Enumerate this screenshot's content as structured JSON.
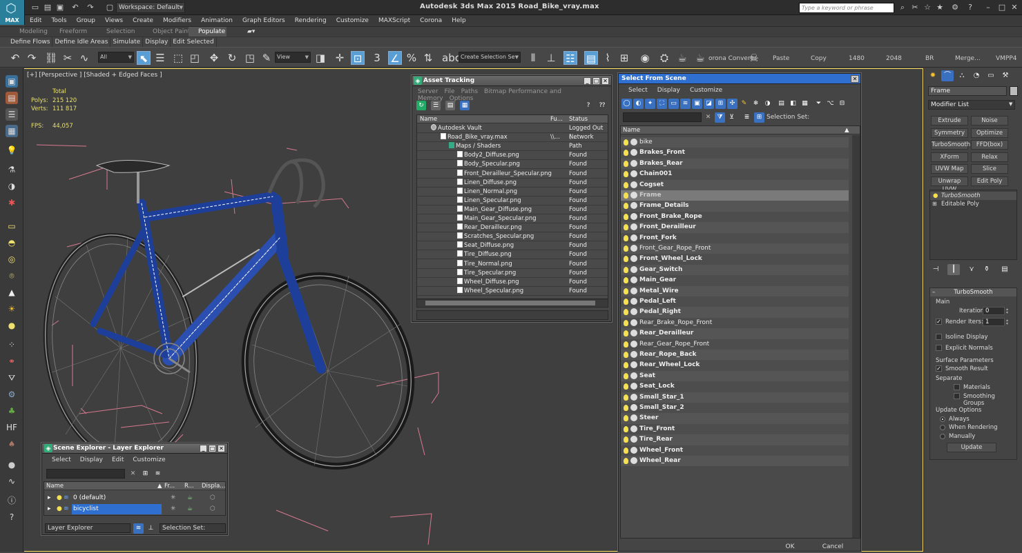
{
  "app": {
    "title": "Autodesk 3ds Max  2015    Road_Bike_vray.max",
    "logo_label": "MAX",
    "workspace": "Workspace: Default",
    "search_placeholder": "Type a keyword or phrase"
  },
  "menu": [
    "Edit",
    "Tools",
    "Group",
    "Views",
    "Create",
    "Modifiers",
    "Animation",
    "Graph Editors",
    "Rendering",
    "Customize",
    "MAXScript",
    "Corona",
    "Help"
  ],
  "ribbon": {
    "tabs": [
      "Modeling",
      "Freeform",
      "Selection",
      "Object Paint",
      "Populate"
    ],
    "active_tab": "Populate",
    "subitems": [
      "Define Flows",
      "Define Idle Areas",
      "Simulate",
      "Display",
      "Edit Selected"
    ]
  },
  "toolbar": {
    "filter": "All",
    "view": "View",
    "selection_set": "Create Selection Se",
    "labels": [
      "orona Convert",
      "Paste",
      "Copy",
      "1480",
      "2048",
      "BR",
      "Merge...",
      "VMPP4"
    ]
  },
  "viewport": {
    "label": "[+] [Perspective ] [Shaded + Edged Faces ]",
    "stats_header": "Total",
    "polys_label": "Polys:",
    "polys": "215 120",
    "verts_label": "Verts:",
    "verts": "111 817",
    "fps_label": "FPS:",
    "fps": "44,057"
  },
  "command_panel": {
    "object_name": "Frame",
    "modifier_list": "Modifier List",
    "buttons": [
      "Extrude",
      "Noise",
      "Symmetry",
      "Optimize",
      "TurboSmooth",
      "FFD(box)",
      "XForm",
      "Relax",
      "UVW Map",
      "Slice",
      "Unwrap UVW",
      "Edit Poly"
    ],
    "stack": [
      "TurboSmooth",
      "Editable Poly"
    ],
    "rollout_title": "TurboSmooth",
    "main_label": "Main",
    "iterations_label": "Iterations:",
    "iterations": "0",
    "render_iters_label": "Render Iters:",
    "render_iters": "1",
    "isoline": "Isoline Display",
    "explicit": "Explicit Normals",
    "surface_label": "Surface Parameters",
    "smooth_result": "Smooth Result",
    "separate_label": "Separate",
    "materials": "Materials",
    "smoothing_groups": "Smoothing Groups",
    "update_label": "Update Options",
    "always": "Always",
    "when_rendering": "When Rendering",
    "manually": "Manually",
    "update_btn": "Update"
  },
  "asset_tracking": {
    "title": "Asset Tracking",
    "menu": [
      "Server",
      "File",
      "Paths",
      "Bitmap Performance and Memory",
      "Options"
    ],
    "columns": [
      "Name",
      "Fu...",
      "Status"
    ],
    "rows": [
      {
        "name": "Autodesk Vault",
        "full": "",
        "status": "Logged Out (..."
      },
      {
        "name": "Road_Bike_vray.max",
        "full": "\\\\...",
        "status": "Network Path"
      },
      {
        "name": "Maps / Shaders",
        "full": "",
        "status": ""
      },
      {
        "name": "Body2_Diffuse.png",
        "full": "",
        "status": "Found"
      },
      {
        "name": "Body_Specular.png",
        "full": "",
        "status": "Found"
      },
      {
        "name": "Front_Derailleur_Specular.png",
        "full": "",
        "status": "Found"
      },
      {
        "name": "Linen_Diffuse.png",
        "full": "",
        "status": "Found"
      },
      {
        "name": "Linen_Normal.png",
        "full": "",
        "status": "Found"
      },
      {
        "name": "Linen_Specular.png",
        "full": "",
        "status": "Found"
      },
      {
        "name": "Main_Gear_Diffuse.png",
        "full": "",
        "status": "Found"
      },
      {
        "name": "Main_Gear_Specular.png",
        "full": "",
        "status": "Found"
      },
      {
        "name": "Rear_Derailleur.png",
        "full": "",
        "status": "Found"
      },
      {
        "name": "Scratches_Specular.png",
        "full": "",
        "status": "Found"
      },
      {
        "name": "Seat_Diffuse.png",
        "full": "",
        "status": "Found"
      },
      {
        "name": "Tire_Diffuse.png",
        "full": "",
        "status": "Found"
      },
      {
        "name": "Tire_Normal.png",
        "full": "",
        "status": "Found"
      },
      {
        "name": "Tire_Specular.png",
        "full": "",
        "status": "Found"
      },
      {
        "name": "Wheel_Diffuse.png",
        "full": "",
        "status": "Found"
      },
      {
        "name": "Wheel_Specular.png",
        "full": "",
        "status": "Found"
      }
    ]
  },
  "select_from_scene": {
    "title": "Select From Scene",
    "menu": [
      "Select",
      "Display",
      "Customize"
    ],
    "selection_set_label": "Selection Set:",
    "column": "Name",
    "items": [
      {
        "name": "bike",
        "bold": false
      },
      {
        "name": "Brakes_Front",
        "bold": true
      },
      {
        "name": "Brakes_Rear",
        "bold": true
      },
      {
        "name": "Chain001",
        "bold": true
      },
      {
        "name": "Cogset",
        "bold": true
      },
      {
        "name": "Frame",
        "bold": true,
        "selected": true
      },
      {
        "name": "Frame_Details",
        "bold": true
      },
      {
        "name": "Front_Brake_Rope",
        "bold": true
      },
      {
        "name": "Front_Derailleur",
        "bold": true
      },
      {
        "name": "Front_Fork",
        "bold": true
      },
      {
        "name": "Front_Gear_Rope_Front",
        "bold": false
      },
      {
        "name": "Front_Wheel_Lock",
        "bold": true
      },
      {
        "name": "Gear_Switch",
        "bold": true
      },
      {
        "name": "Main_Gear",
        "bold": true
      },
      {
        "name": "Metal_Wire",
        "bold": true
      },
      {
        "name": "Pedal_Left",
        "bold": true
      },
      {
        "name": "Pedal_Right",
        "bold": true
      },
      {
        "name": "Rear_Brake_Rope_Front",
        "bold": false
      },
      {
        "name": "Rear_Derailleur",
        "bold": true
      },
      {
        "name": "Rear_Gear_Rope_Front",
        "bold": false
      },
      {
        "name": "Rear_Rope_Back",
        "bold": true
      },
      {
        "name": "Rear_Wheel_Lock",
        "bold": true
      },
      {
        "name": "Seat",
        "bold": true
      },
      {
        "name": "Seat_Lock",
        "bold": true
      },
      {
        "name": "Small_Star_1",
        "bold": true
      },
      {
        "name": "Small_Star_2",
        "bold": true
      },
      {
        "name": "Steer",
        "bold": true
      },
      {
        "name": "Tire_Front",
        "bold": true
      },
      {
        "name": "Tire_Rear",
        "bold": true
      },
      {
        "name": "Wheel_Front",
        "bold": true
      },
      {
        "name": "Wheel_Rear",
        "bold": true
      }
    ],
    "ok": "OK",
    "cancel": "Cancel"
  },
  "scene_explorer": {
    "title": "Scene Explorer - Layer Explorer",
    "menu": [
      "Select",
      "Display",
      "Edit",
      "Customize"
    ],
    "columns": [
      "Name",
      "Fr...",
      "R...",
      "Displa..."
    ],
    "layers": [
      {
        "name": "0 (default)",
        "selected": false
      },
      {
        "name": "bicyclist",
        "selected": true
      }
    ],
    "explorer_dropdown": "Layer Explorer",
    "selection_set": "Selection Set:"
  },
  "colors": {
    "accent_blue": "#2f6fd0",
    "viewport_bg": "#3f3f3f",
    "frame_blue": "#1d3f9a",
    "highlight_yellow": "#ffe060",
    "bbox_pink": "#d87a90"
  }
}
